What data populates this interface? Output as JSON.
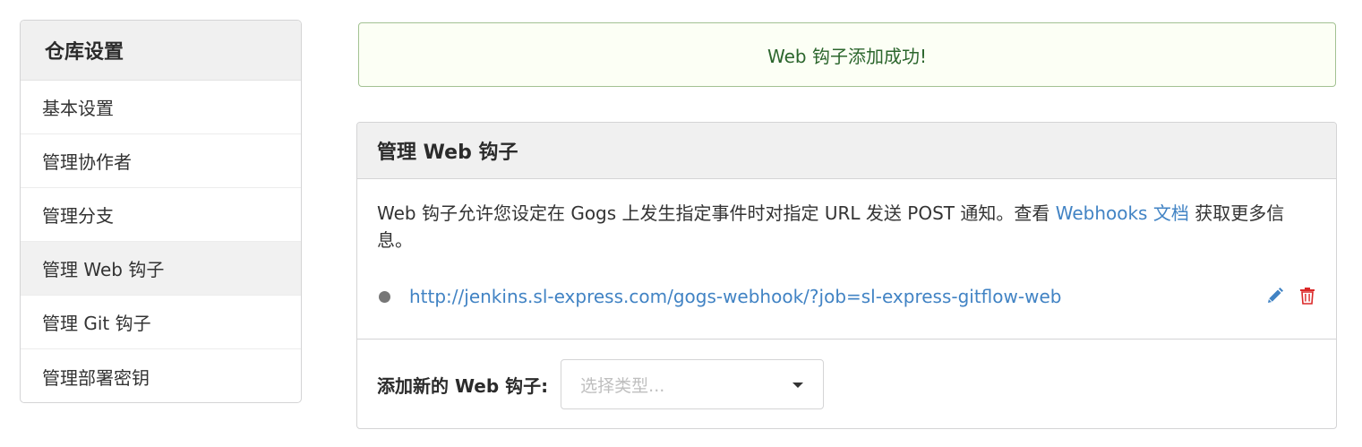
{
  "sidebar": {
    "title": "仓库设置",
    "items": [
      {
        "label": "基本设置"
      },
      {
        "label": "管理协作者"
      },
      {
        "label": "管理分支"
      },
      {
        "label": "管理 Web 钩子"
      },
      {
        "label": "管理 Git 钩子"
      },
      {
        "label": "管理部署密钥"
      }
    ],
    "active_index": 3
  },
  "alert": {
    "message": "Web 钩子添加成功!"
  },
  "webhooks": {
    "title": "管理 Web 钩子",
    "description_prefix": "Web 钩子允许您设定在 Gogs 上发生指定事件时对指定 URL 发送 POST 通知。查看 ",
    "docs_link": "Webhooks 文档",
    "description_suffix": " 获取更多信息。",
    "hooks": [
      {
        "url": "http://jenkins.sl-express.com/gogs-webhook/?job=sl-express-gitflow-web"
      }
    ],
    "edit_icon": "pencil-icon",
    "delete_icon": "trash-icon",
    "add_label": "添加新的 Web 钩子:",
    "type_select_placeholder": "选择类型..."
  },
  "colors": {
    "link": "#4183c4",
    "success_text": "#2c662d",
    "success_border": "#a3c293",
    "success_bg": "#fcfff5",
    "danger": "#db2828",
    "header_bg": "#f0f0f0"
  }
}
